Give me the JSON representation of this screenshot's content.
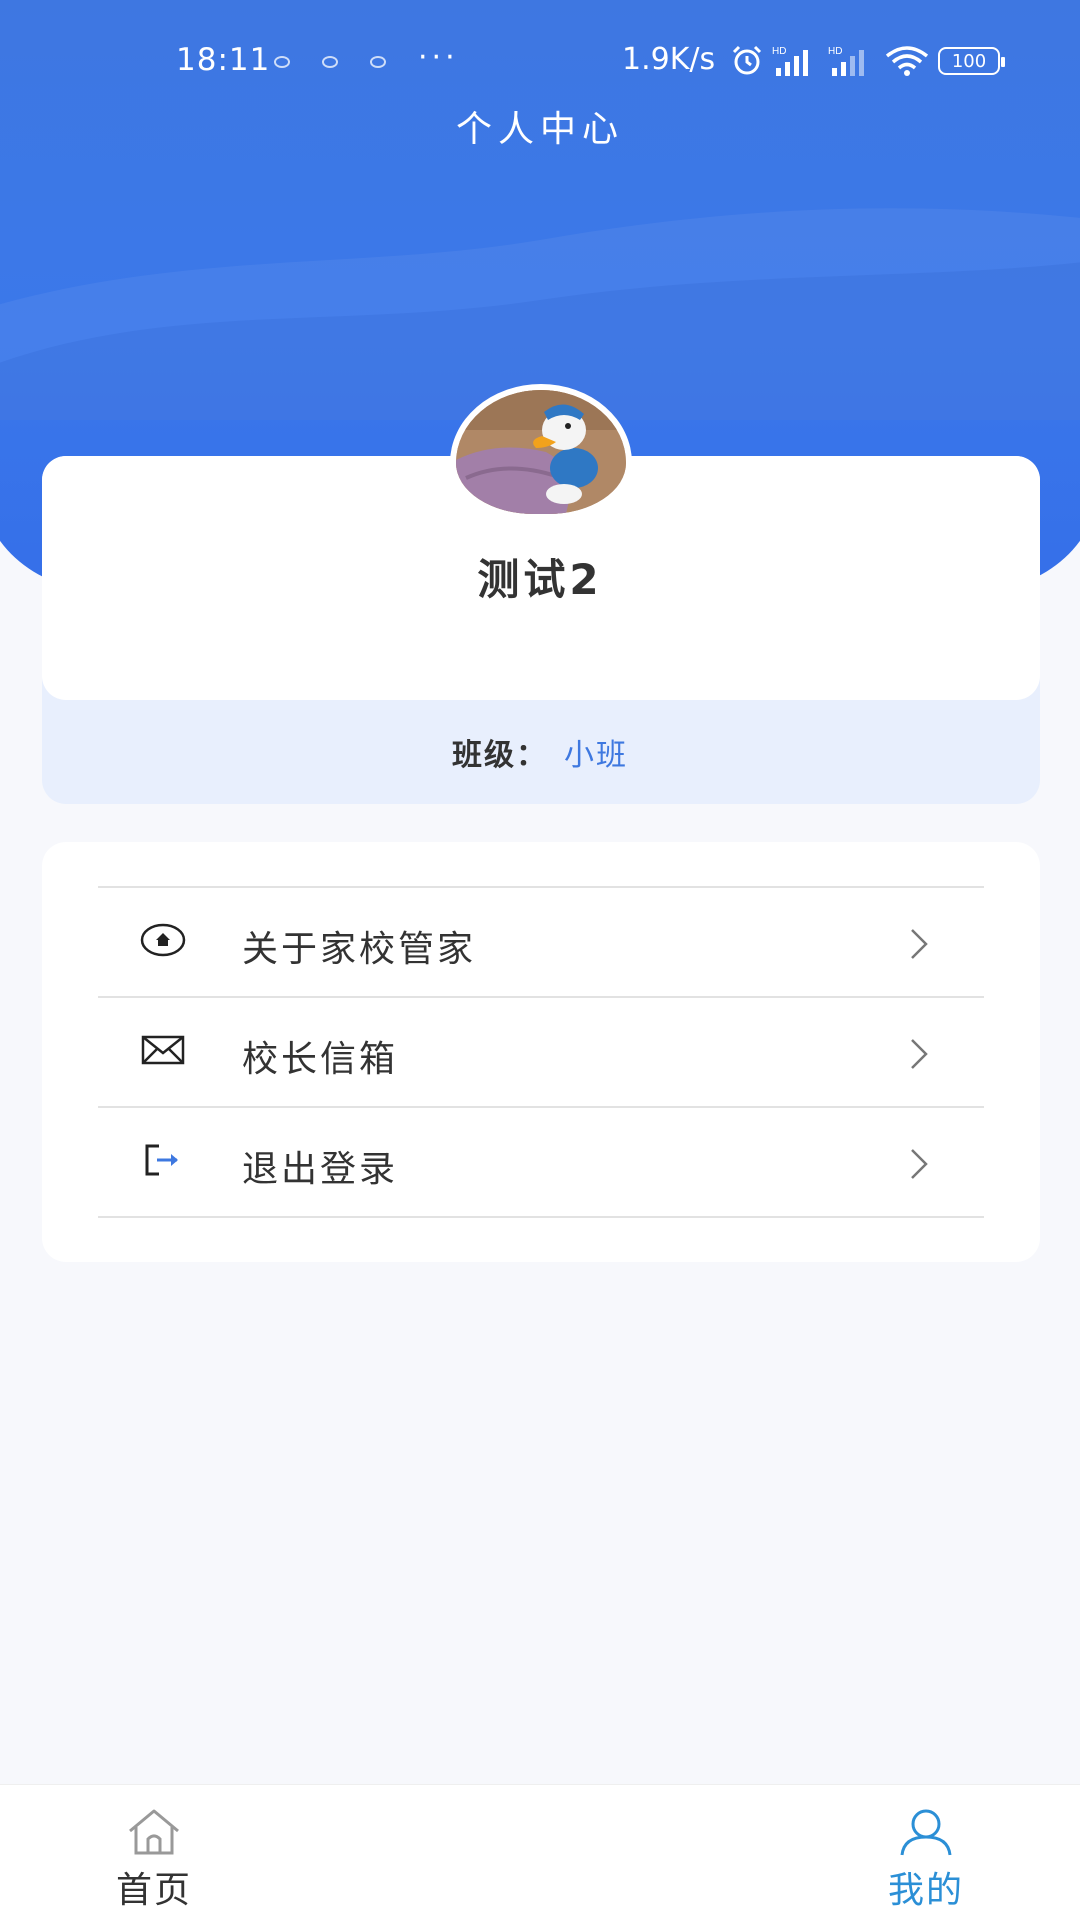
{
  "status_bar": {
    "time": "18:11",
    "dots": "···",
    "net_speed": "1.9K/s",
    "battery": "100",
    "icons": [
      "alarm-icon",
      "signal-hd-icon",
      "signal-hd-icon",
      "wifi-icon",
      "battery-icon"
    ]
  },
  "header": {
    "title": "个人中心"
  },
  "profile": {
    "name": "测试2",
    "class_label": "班级：",
    "class_value": "小班"
  },
  "menu": {
    "items": [
      {
        "label": "关于家校管家",
        "icon": "home-circle-icon"
      },
      {
        "label": "校长信箱",
        "icon": "mail-icon"
      },
      {
        "label": "退出登录",
        "icon": "logout-icon"
      }
    ]
  },
  "tabs": {
    "home": "首页",
    "mine": "我的"
  },
  "colors": {
    "header_blue": "#3b78ea",
    "accent_blue": "#3e78e0",
    "tab_active": "#2b8fd6",
    "page_bg": "#f7f8fc"
  }
}
